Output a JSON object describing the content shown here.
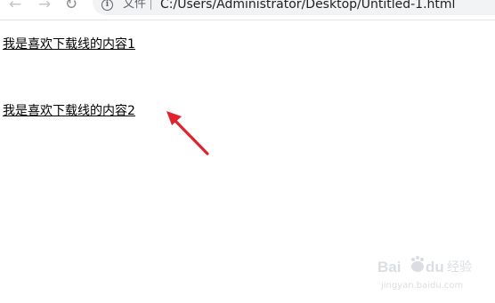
{
  "browser": {
    "back_icon": "arrow-left-icon",
    "forward_icon": "arrow-right-icon",
    "reload_icon": "reload-icon",
    "address_bar": {
      "info_icon": "info-icon",
      "scheme_label": "文件",
      "url": "C:/Users/Administrator/Desktop/Untitled-1.html"
    }
  },
  "page": {
    "links": [
      "我是喜欢下载线的内容1",
      "",
      "我是喜欢下载线的内容2"
    ]
  },
  "annotation": {
    "arrow_color": "#e0232c"
  },
  "watermark": {
    "logo_text": "Baidu 经验",
    "site": "jingyan.baidu.com"
  }
}
